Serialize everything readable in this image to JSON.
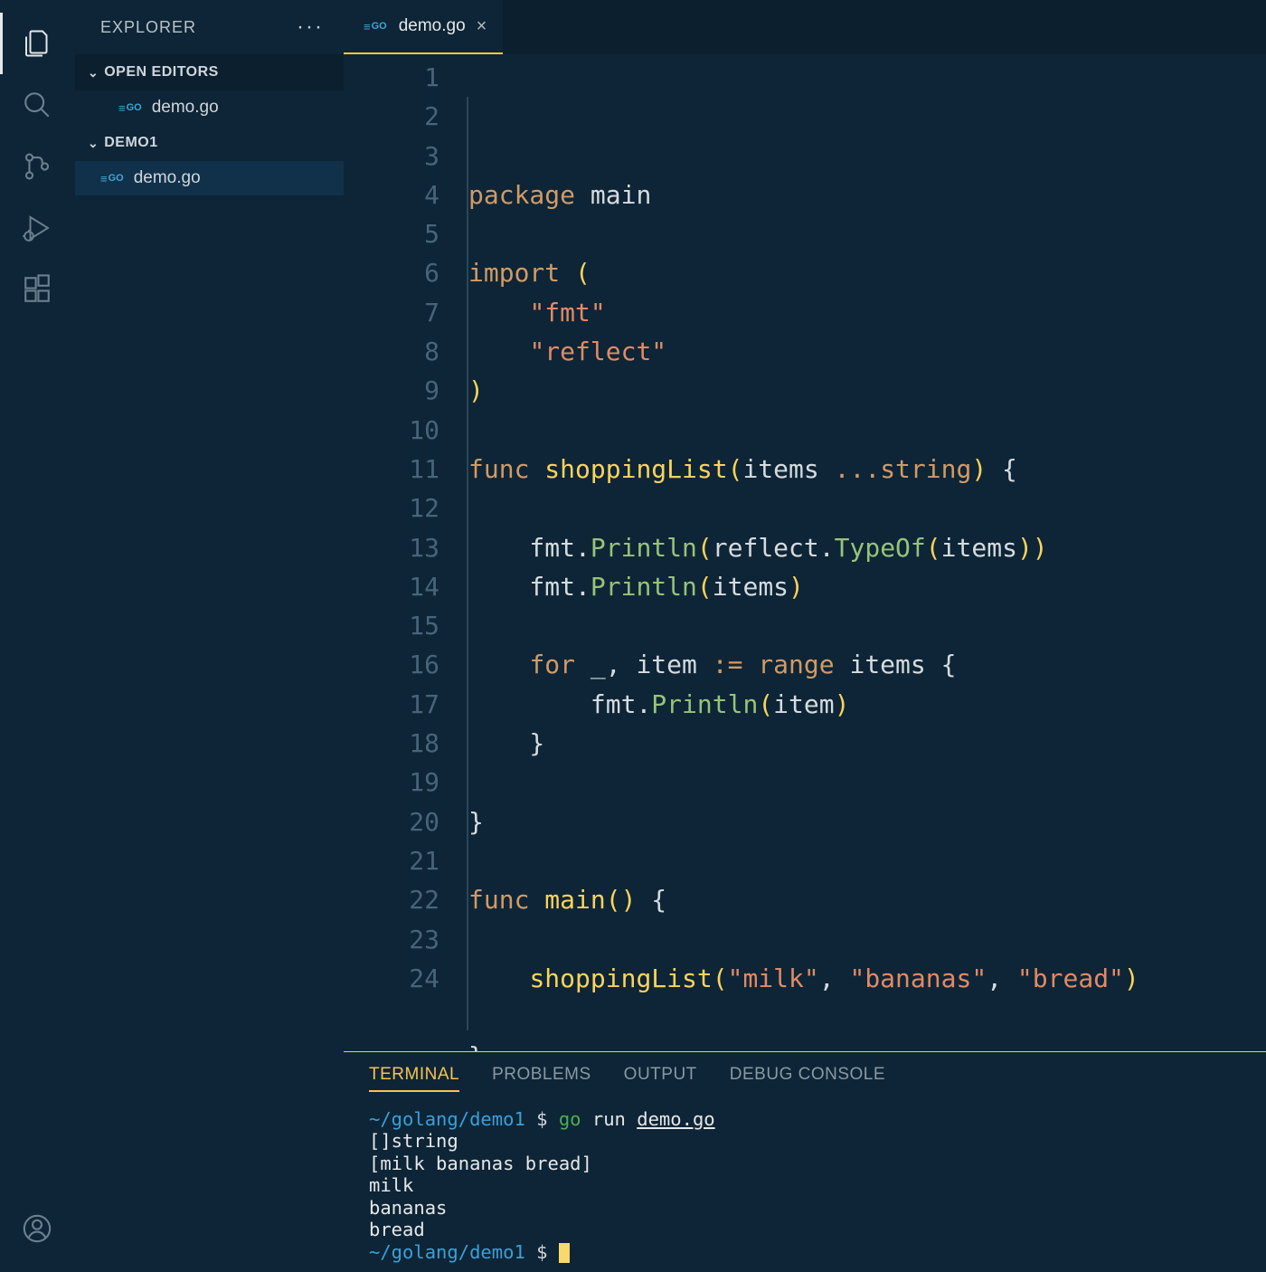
{
  "sidebar": {
    "title": "EXPLORER",
    "open_editors_label": "OPEN EDITORS",
    "folder_label": "DEMO1",
    "open_editors": [
      {
        "name": "demo.go"
      }
    ],
    "files": [
      {
        "name": "demo.go"
      }
    ]
  },
  "tabs": [
    {
      "label": "demo.go",
      "active": true
    }
  ],
  "icons": {
    "go_badge": "GO"
  },
  "editor": {
    "lines": [
      {
        "n": 1,
        "segments": [
          {
            "text": "package",
            "cls": "kw"
          },
          {
            "text": " main",
            "cls": "id"
          }
        ]
      },
      {
        "n": 2,
        "segments": []
      },
      {
        "n": 3,
        "segments": [
          {
            "text": "import",
            "cls": "kw"
          },
          {
            "text": " (",
            "cls": "fn"
          }
        ]
      },
      {
        "n": 4,
        "segments": [
          {
            "text": "    ",
            "cls": ""
          },
          {
            "text": "\"fmt\"",
            "cls": "str"
          }
        ]
      },
      {
        "n": 5,
        "segments": [
          {
            "text": "    ",
            "cls": ""
          },
          {
            "text": "\"reflect\"",
            "cls": "str"
          }
        ]
      },
      {
        "n": 6,
        "segments": [
          {
            "text": ")",
            "cls": "fn"
          }
        ]
      },
      {
        "n": 7,
        "segments": []
      },
      {
        "n": 8,
        "segments": [
          {
            "text": "func",
            "cls": "kw"
          },
          {
            "text": " ",
            "cls": ""
          },
          {
            "text": "shoppingList",
            "cls": "fn"
          },
          {
            "text": "(",
            "cls": "fn"
          },
          {
            "text": "items ",
            "cls": "id"
          },
          {
            "text": "...",
            "cls": "kw"
          },
          {
            "text": "string",
            "cls": "kw"
          },
          {
            "text": ")",
            "cls": "fn"
          },
          {
            "text": " {",
            "cls": "id"
          }
        ]
      },
      {
        "n": 9,
        "segments": []
      },
      {
        "n": 10,
        "segments": [
          {
            "text": "    fmt",
            "cls": "id"
          },
          {
            "text": ".",
            "cls": "punc"
          },
          {
            "text": "Println",
            "cls": "mfn"
          },
          {
            "text": "(",
            "cls": "fn"
          },
          {
            "text": "reflect",
            "cls": "id"
          },
          {
            "text": ".",
            "cls": "punc"
          },
          {
            "text": "TypeOf",
            "cls": "mfn"
          },
          {
            "text": "(",
            "cls": "fn"
          },
          {
            "text": "items",
            "cls": "id"
          },
          {
            "text": "))",
            "cls": "fn"
          }
        ]
      },
      {
        "n": 11,
        "segments": [
          {
            "text": "    fmt",
            "cls": "id"
          },
          {
            "text": ".",
            "cls": "punc"
          },
          {
            "text": "Println",
            "cls": "mfn"
          },
          {
            "text": "(",
            "cls": "fn"
          },
          {
            "text": "items",
            "cls": "id"
          },
          {
            "text": ")",
            "cls": "fn"
          }
        ]
      },
      {
        "n": 12,
        "segments": []
      },
      {
        "n": 13,
        "segments": [
          {
            "text": "    ",
            "cls": ""
          },
          {
            "text": "for",
            "cls": "kw"
          },
          {
            "text": " _, item ",
            "cls": "id"
          },
          {
            "text": ":=",
            "cls": "kw"
          },
          {
            "text": " ",
            "cls": ""
          },
          {
            "text": "range",
            "cls": "kw"
          },
          {
            "text": " items {",
            "cls": "id"
          }
        ]
      },
      {
        "n": 14,
        "segments": [
          {
            "text": "        fmt",
            "cls": "id"
          },
          {
            "text": ".",
            "cls": "punc"
          },
          {
            "text": "Println",
            "cls": "mfn"
          },
          {
            "text": "(",
            "cls": "fn"
          },
          {
            "text": "item",
            "cls": "id"
          },
          {
            "text": ")",
            "cls": "fn"
          }
        ]
      },
      {
        "n": 15,
        "segments": [
          {
            "text": "    }",
            "cls": "id"
          }
        ]
      },
      {
        "n": 16,
        "segments": []
      },
      {
        "n": 17,
        "segments": [
          {
            "text": "}",
            "cls": "id"
          }
        ]
      },
      {
        "n": 18,
        "segments": []
      },
      {
        "n": 19,
        "segments": [
          {
            "text": "func",
            "cls": "kw"
          },
          {
            "text": " ",
            "cls": ""
          },
          {
            "text": "main",
            "cls": "fn"
          },
          {
            "text": "()",
            "cls": "fn"
          },
          {
            "text": " {",
            "cls": "id"
          }
        ]
      },
      {
        "n": 20,
        "segments": []
      },
      {
        "n": 21,
        "segments": [
          {
            "text": "    ",
            "cls": ""
          },
          {
            "text": "shoppingList",
            "cls": "fn"
          },
          {
            "text": "(",
            "cls": "fn"
          },
          {
            "text": "\"milk\"",
            "cls": "str"
          },
          {
            "text": ", ",
            "cls": "id"
          },
          {
            "text": "\"bananas\"",
            "cls": "str"
          },
          {
            "text": ", ",
            "cls": "id"
          },
          {
            "text": "\"bread\"",
            "cls": "str"
          },
          {
            "text": ")",
            "cls": "fn"
          }
        ]
      },
      {
        "n": 22,
        "segments": []
      },
      {
        "n": 23,
        "segments": [
          {
            "text": "}",
            "cls": "id"
          }
        ]
      },
      {
        "n": 24,
        "segments": []
      }
    ]
  },
  "panel": {
    "tabs": [
      "TERMINAL",
      "PROBLEMS",
      "OUTPUT",
      "DEBUG CONSOLE"
    ],
    "active_tab": 0
  },
  "terminal": {
    "path": "~/golang/demo1",
    "prompt": "$",
    "command_bin": "go",
    "command_rest": "run ",
    "command_file": "demo.go",
    "output": [
      "[]string",
      "[milk bananas bread]",
      "milk",
      "bananas",
      "bread"
    ]
  }
}
